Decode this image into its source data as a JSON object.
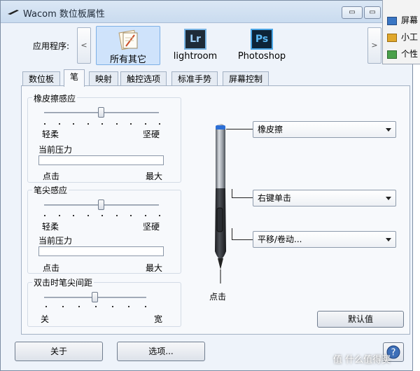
{
  "window": {
    "title": "Wacom 数位板属性",
    "min_glyph": "▭",
    "max_glyph": "▭"
  },
  "side_menu": {
    "items": [
      "屏幕",
      "小工",
      "个性"
    ]
  },
  "apps": {
    "label": "应用程序:",
    "left_arrow": "<",
    "right_arrow": ">",
    "items": [
      {
        "label": "所有其它",
        "icon": "all-others-icon"
      },
      {
        "label": "lightroom",
        "icon_text": "Lr"
      },
      {
        "label": "Photoshop",
        "icon_text": "Ps"
      }
    ]
  },
  "tabs": [
    "数位板",
    "笔",
    "映射",
    "触控选项",
    "标准手势",
    "屏幕控制"
  ],
  "eraser_feel": {
    "title": "橡皮擦感应",
    "left": "轻柔",
    "right": "坚硬",
    "pressure_label": "当前压力",
    "min": "点击",
    "max": "最大",
    "value_fraction": 0.5
  },
  "tip_feel": {
    "title": "笔尖感应",
    "left": "轻柔",
    "right": "坚硬",
    "pressure_label": "当前压力",
    "min": "点击",
    "max": "最大",
    "value_fraction": 0.5
  },
  "double_click": {
    "title": "双击时笔尖间距",
    "left": "关",
    "right": "宽",
    "value_fraction": 0.5
  },
  "pen": {
    "eraser_action": "橡皮擦",
    "upper_button": "右键单击",
    "lower_button": "平移/卷动...",
    "tip_label": "点击"
  },
  "buttons": {
    "default": "默认值",
    "about": "关于",
    "options": "选项...",
    "help": "?"
  },
  "watermark": "值 什么值得买"
}
